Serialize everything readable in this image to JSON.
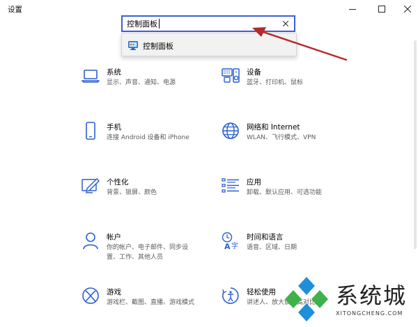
{
  "window": {
    "title": "设置",
    "controls": [
      "minimize-icon",
      "maximize-icon",
      "close-icon"
    ]
  },
  "search": {
    "value": "控制面板",
    "clear_icon": "close-icon"
  },
  "suggestion": {
    "label": "控制面板",
    "icon": "control-panel-icon"
  },
  "categories": [
    {
      "title": "系统",
      "desc": [
        "显示、声音、通知、电源"
      ],
      "icon": "laptop-icon"
    },
    {
      "title": "设备",
      "desc": [
        "蓝牙、打印机、鼠标"
      ],
      "icon": "keyboard-speaker-icon"
    },
    {
      "title": "手机",
      "desc": [
        "连接 Android 设备和 iPhone"
      ],
      "icon": "phone-icon"
    },
    {
      "title": "网络和 Internet",
      "desc": [
        "WLAN、飞行模式、VPN"
      ],
      "icon": "globe-icon"
    },
    {
      "title": "个性化",
      "desc": [
        "背景、锁屏、颜色"
      ],
      "icon": "paint-icon"
    },
    {
      "title": "应用",
      "desc": [
        "卸载、默认应用、可选功能"
      ],
      "icon": "apps-list-icon"
    },
    {
      "title": "帐户",
      "desc": [
        "你的帐户、电子邮件、同步设",
        "置、工作、其他人员"
      ],
      "icon": "person-icon"
    },
    {
      "title": "时间和语言",
      "desc": [
        "语音、区域、日期"
      ],
      "icon": "time-language-icon"
    },
    {
      "title": "游戏",
      "desc": [
        "游戏栏、截图、直播、游戏模式"
      ],
      "icon": "xbox-icon"
    },
    {
      "title": "轻松使用",
      "desc": [
        "讲述人、放大镜、高对比度"
      ],
      "icon": "ease-of-access-icon"
    }
  ],
  "watermark": {
    "text": "系统城",
    "url": "XITONGCHENG.COM"
  },
  "colors": {
    "accent": "#2b5fce",
    "search_border": "#3d5ed6",
    "annotation_arrow": "#b52a2a",
    "watermark_blue": "#1f8fd9",
    "watermark_green": "#3fb14a"
  }
}
